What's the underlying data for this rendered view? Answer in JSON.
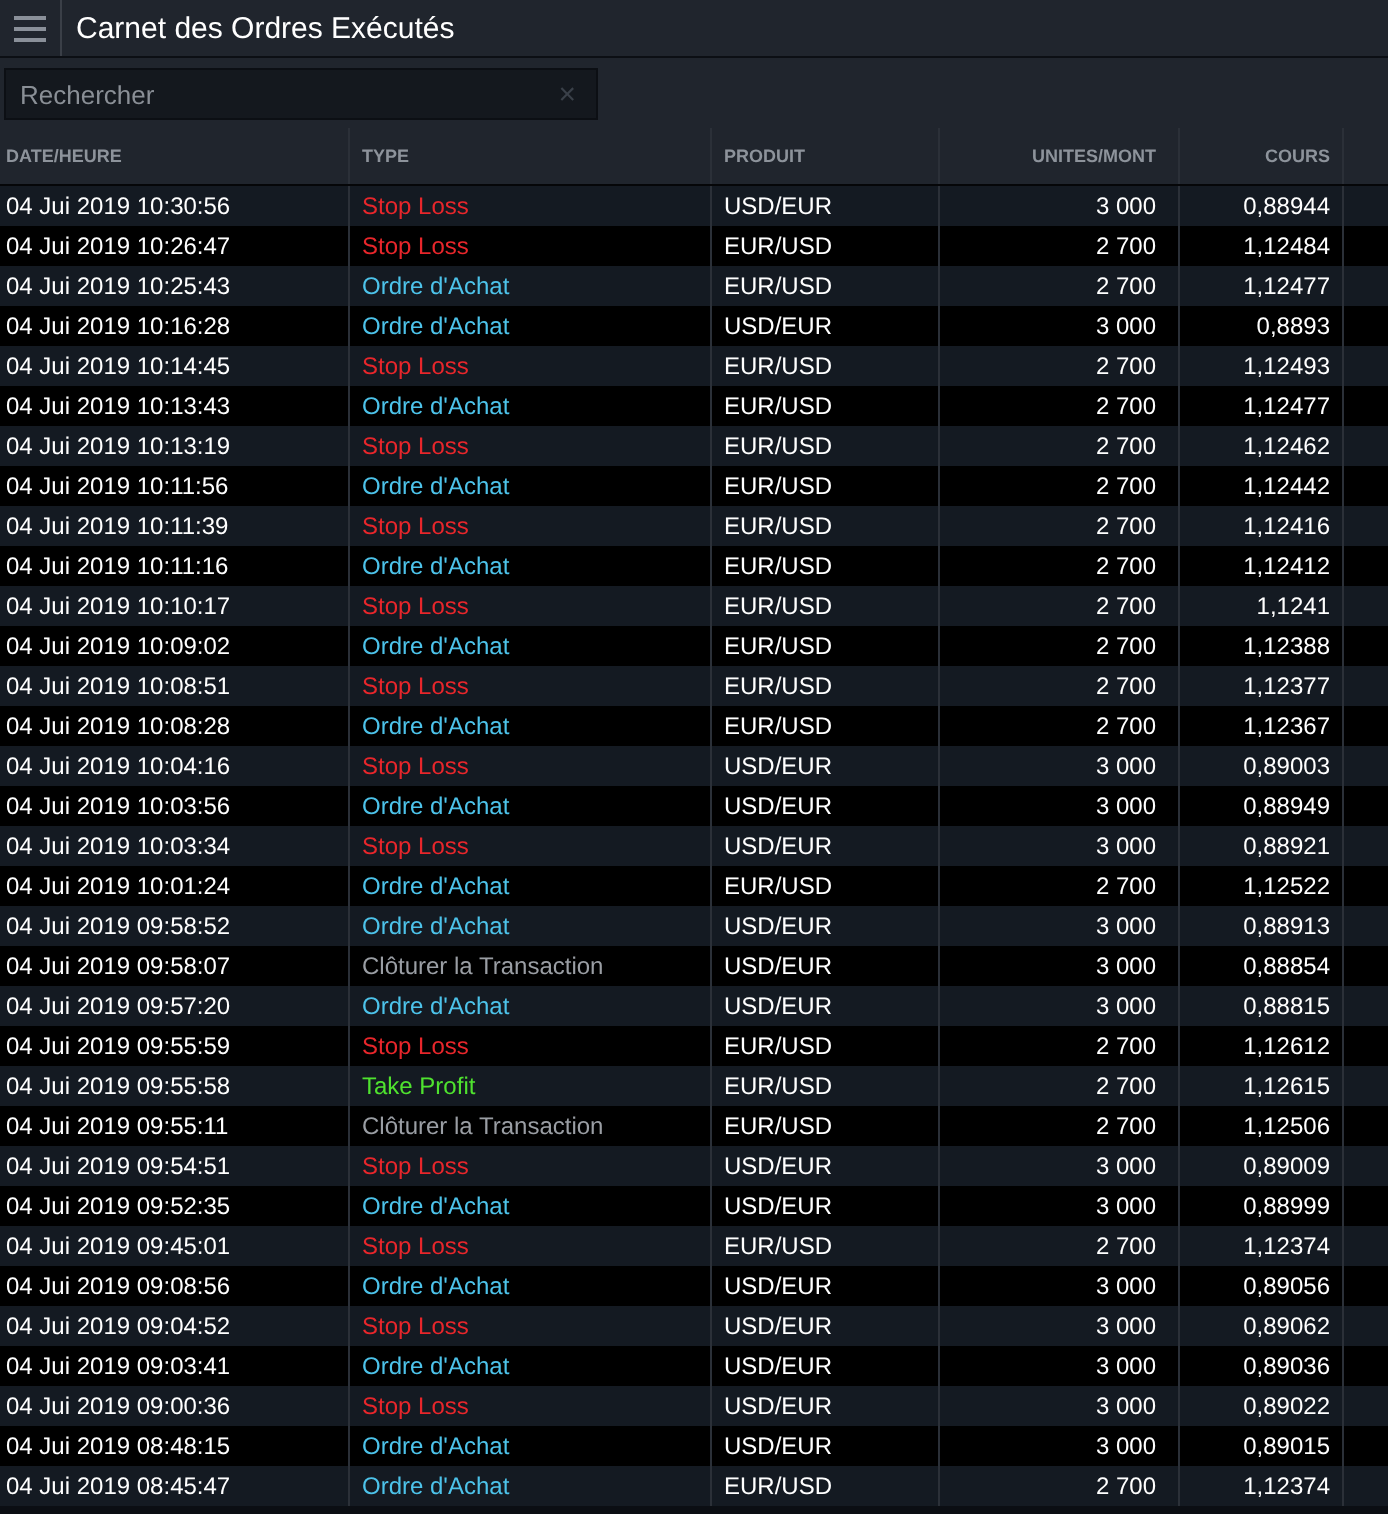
{
  "window": {
    "title": "Carnet des Ordres Exécutés"
  },
  "search": {
    "placeholder": "Rechercher",
    "clear": "×"
  },
  "table": {
    "columns": [
      "DATE/HEURE",
      "TYPE",
      "PRODUIT",
      "UNITES/MONT",
      "COURS"
    ],
    "rows": [
      {
        "date": "04 Jui 2019 10:30:56",
        "type": "Stop Loss",
        "kind": "stop",
        "product": "USD/EUR",
        "units": "3 000",
        "rate": "0,88944"
      },
      {
        "date": "04 Jui 2019 10:26:47",
        "type": "Stop Loss",
        "kind": "stop",
        "product": "EUR/USD",
        "units": "2 700",
        "rate": "1,12484"
      },
      {
        "date": "04 Jui 2019 10:25:43",
        "type": "Ordre d'Achat",
        "kind": "buy",
        "product": "EUR/USD",
        "units": "2 700",
        "rate": "1,12477"
      },
      {
        "date": "04 Jui 2019 10:16:28",
        "type": "Ordre d'Achat",
        "kind": "buy",
        "product": "USD/EUR",
        "units": "3 000",
        "rate": "0,8893"
      },
      {
        "date": "04 Jui 2019 10:14:45",
        "type": "Stop Loss",
        "kind": "stop",
        "product": "EUR/USD",
        "units": "2 700",
        "rate": "1,12493"
      },
      {
        "date": "04 Jui 2019 10:13:43",
        "type": "Ordre d'Achat",
        "kind": "buy",
        "product": "EUR/USD",
        "units": "2 700",
        "rate": "1,12477"
      },
      {
        "date": "04 Jui 2019 10:13:19",
        "type": "Stop Loss",
        "kind": "stop",
        "product": "EUR/USD",
        "units": "2 700",
        "rate": "1,12462"
      },
      {
        "date": "04 Jui 2019 10:11:56",
        "type": "Ordre d'Achat",
        "kind": "buy",
        "product": "EUR/USD",
        "units": "2 700",
        "rate": "1,12442"
      },
      {
        "date": "04 Jui 2019 10:11:39",
        "type": "Stop Loss",
        "kind": "stop",
        "product": "EUR/USD",
        "units": "2 700",
        "rate": "1,12416"
      },
      {
        "date": "04 Jui 2019 10:11:16",
        "type": "Ordre d'Achat",
        "kind": "buy",
        "product": "EUR/USD",
        "units": "2 700",
        "rate": "1,12412"
      },
      {
        "date": "04 Jui 2019 10:10:17",
        "type": "Stop Loss",
        "kind": "stop",
        "product": "EUR/USD",
        "units": "2 700",
        "rate": "1,1241"
      },
      {
        "date": "04 Jui 2019 10:09:02",
        "type": "Ordre d'Achat",
        "kind": "buy",
        "product": "EUR/USD",
        "units": "2 700",
        "rate": "1,12388"
      },
      {
        "date": "04 Jui 2019 10:08:51",
        "type": "Stop Loss",
        "kind": "stop",
        "product": "EUR/USD",
        "units": "2 700",
        "rate": "1,12377"
      },
      {
        "date": "04 Jui 2019 10:08:28",
        "type": "Ordre d'Achat",
        "kind": "buy",
        "product": "EUR/USD",
        "units": "2 700",
        "rate": "1,12367"
      },
      {
        "date": "04 Jui 2019 10:04:16",
        "type": "Stop Loss",
        "kind": "stop",
        "product": "USD/EUR",
        "units": "3 000",
        "rate": "0,89003"
      },
      {
        "date": "04 Jui 2019 10:03:56",
        "type": "Ordre d'Achat",
        "kind": "buy",
        "product": "USD/EUR",
        "units": "3 000",
        "rate": "0,88949"
      },
      {
        "date": "04 Jui 2019 10:03:34",
        "type": "Stop Loss",
        "kind": "stop",
        "product": "USD/EUR",
        "units": "3 000",
        "rate": "0,88921"
      },
      {
        "date": "04 Jui 2019 10:01:24",
        "type": "Ordre d'Achat",
        "kind": "buy",
        "product": "EUR/USD",
        "units": "2 700",
        "rate": "1,12522"
      },
      {
        "date": "04 Jui 2019 09:58:52",
        "type": "Ordre d'Achat",
        "kind": "buy",
        "product": "USD/EUR",
        "units": "3 000",
        "rate": "0,88913"
      },
      {
        "date": "04 Jui 2019 09:58:07",
        "type": "Clôturer la Transaction",
        "kind": "close",
        "product": "USD/EUR",
        "units": "3 000",
        "rate": "0,88854"
      },
      {
        "date": "04 Jui 2019 09:57:20",
        "type": "Ordre d'Achat",
        "kind": "buy",
        "product": "USD/EUR",
        "units": "3 000",
        "rate": "0,88815"
      },
      {
        "date": "04 Jui 2019 09:55:59",
        "type": "Stop Loss",
        "kind": "stop",
        "product": "EUR/USD",
        "units": "2 700",
        "rate": "1,12612"
      },
      {
        "date": "04 Jui 2019 09:55:58",
        "type": "Take Profit",
        "kind": "profit",
        "product": "EUR/USD",
        "units": "2 700",
        "rate": "1,12615"
      },
      {
        "date": "04 Jui 2019 09:55:11",
        "type": "Clôturer la Transaction",
        "kind": "close",
        "product": "EUR/USD",
        "units": "2 700",
        "rate": "1,12506"
      },
      {
        "date": "04 Jui 2019 09:54:51",
        "type": "Stop Loss",
        "kind": "stop",
        "product": "USD/EUR",
        "units": "3 000",
        "rate": "0,89009"
      },
      {
        "date": "04 Jui 2019 09:52:35",
        "type": "Ordre d'Achat",
        "kind": "buy",
        "product": "USD/EUR",
        "units": "3 000",
        "rate": "0,88999"
      },
      {
        "date": "04 Jui 2019 09:45:01",
        "type": "Stop Loss",
        "kind": "stop",
        "product": "EUR/USD",
        "units": "2 700",
        "rate": "1,12374"
      },
      {
        "date": "04 Jui 2019 09:08:56",
        "type": "Ordre d'Achat",
        "kind": "buy",
        "product": "USD/EUR",
        "units": "3 000",
        "rate": "0,89056"
      },
      {
        "date": "04 Jui 2019 09:04:52",
        "type": "Stop Loss",
        "kind": "stop",
        "product": "USD/EUR",
        "units": "3 000",
        "rate": "0,89062"
      },
      {
        "date": "04 Jui 2019 09:03:41",
        "type": "Ordre d'Achat",
        "kind": "buy",
        "product": "USD/EUR",
        "units": "3 000",
        "rate": "0,89036"
      },
      {
        "date": "04 Jui 2019 09:00:36",
        "type": "Stop Loss",
        "kind": "stop",
        "product": "USD/EUR",
        "units": "3 000",
        "rate": "0,89022"
      },
      {
        "date": "04 Jui 2019 08:48:15",
        "type": "Ordre d'Achat",
        "kind": "buy",
        "product": "USD/EUR",
        "units": "3 000",
        "rate": "0,89015"
      },
      {
        "date": "04 Jui 2019 08:45:47",
        "type": "Ordre d'Achat",
        "kind": "buy",
        "product": "EUR/USD",
        "units": "2 700",
        "rate": "1,12374"
      }
    ]
  }
}
